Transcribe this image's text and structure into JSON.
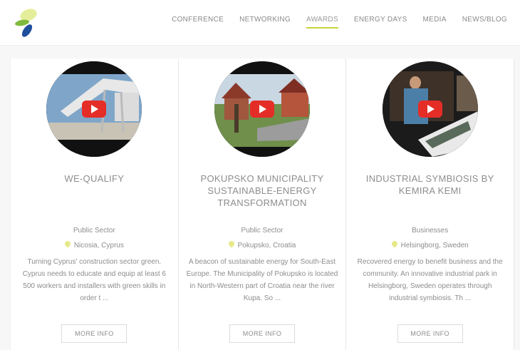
{
  "nav": {
    "items": [
      {
        "label": "CONFERENCE",
        "active": false
      },
      {
        "label": "NETWORKING",
        "active": false
      },
      {
        "label": "AWARDS",
        "active": true
      },
      {
        "label": "ENERGY DAYS",
        "active": false
      },
      {
        "label": "MEDIA",
        "active": false
      },
      {
        "label": "NEWS/BLOG",
        "active": false
      }
    ]
  },
  "colors": {
    "accent": "#c8d43a",
    "logo_green": "#7fba3c",
    "logo_blue": "#1f4e9c",
    "play_red": "#e52d27"
  },
  "cards": [
    {
      "title": "WE-QUALIFY",
      "sector": "Public Sector",
      "location": "Nicosia, Cyprus",
      "description": "Turning Cyprus' construction sector green. Cyprus needs to educate and equip at least 6 500 workers and installers with green skills in order t ...",
      "button": "MORE INFO"
    },
    {
      "title": "POKUPSKO MUNICIPALITY SUSTAINABLE-ENERGY TRANSFORMATION",
      "sector": "Public Sector",
      "location": "Pokupsko, Croatia",
      "description": "A beacon of sustainable energy for South-East Europe. The Municipality of Pokupsko is located in North-Western part of Croatia near the river Kupa. So ...",
      "button": "MORE INFO"
    },
    {
      "title": "INDUSTRIAL SYMBIOSIS BY KEMIRA KEMI",
      "sector": "Businesses",
      "location": "Helsingborg, Sweden",
      "description": "Recovered energy to benefit business and the community. An innovative industrial park in Helsingborg, Sweden operates through industrial symbiosis. Th ...",
      "button": "MORE INFO"
    }
  ]
}
